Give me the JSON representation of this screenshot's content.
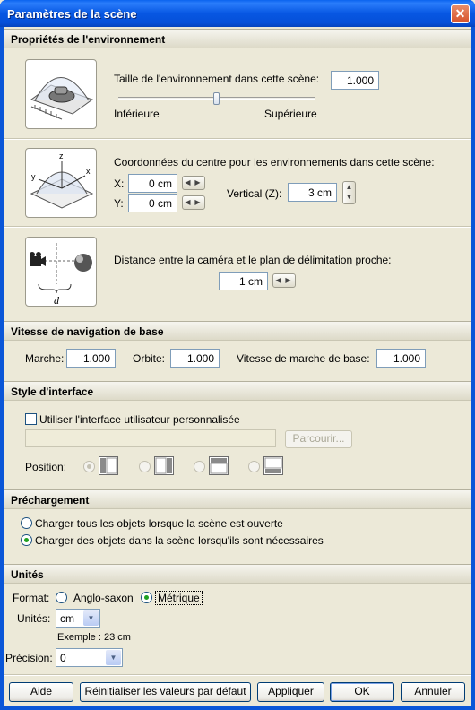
{
  "window": {
    "title": "Paramètres de la scène",
    "close": "✕"
  },
  "sections": {
    "env": "Propriétés de l'environnement",
    "nav": "Vitesse de navigation de base",
    "iface": "Style d'interface",
    "preload": "Préchargement",
    "units": "Unités"
  },
  "env": {
    "size_label": "Taille de l'environnement dans cette scène:",
    "size_value": "1.000",
    "slider_min": "Inférieure",
    "slider_max": "Supérieure",
    "slider_fraction": 0.5,
    "center_label": "Coordonnées du centre pour les environnements dans cette scène:",
    "x_label": "X:",
    "x_value": "0 cm",
    "y_label": "Y:",
    "y_value": "0 cm",
    "vertical_label": "Vertical (Z):",
    "z_value": "3 cm",
    "axis_z": "z",
    "axis_y": "y",
    "axis_x": "x",
    "distance_label": "Distance entre la caméra et le plan de délimitation proche:",
    "distance_value": "1 cm",
    "distance_symbol": "d"
  },
  "nav": {
    "walk_label": "Marche:",
    "walk_value": "1.000",
    "orbit_label": "Orbite:",
    "orbit_value": "1.000",
    "base_label": "Vitesse de marche de base:",
    "base_value": "1.000"
  },
  "iface": {
    "custom_label": "Utiliser l'interface utilisateur personnalisée",
    "path_value": "",
    "browse_label": "Parcourir...",
    "position_label": "Position:"
  },
  "preload": {
    "option1": "Charger tous les objets lorsque la scène est ouverte",
    "option2": "Charger des objets dans la scène lorsqu'ils sont nécessaires"
  },
  "units": {
    "format_label": "Format:",
    "imperial_label": "Anglo-saxon",
    "metric_label": "Métrique",
    "units_label": "Unités:",
    "units_value": "cm",
    "example": "Exemple : 23 cm",
    "precision_label": "Précision:",
    "precision_value": "0"
  },
  "footer": {
    "help": "Aide",
    "reset": "Réinitialiser les valeurs par défaut",
    "apply": "Appliquer",
    "ok": "OK",
    "cancel": "Annuler"
  }
}
